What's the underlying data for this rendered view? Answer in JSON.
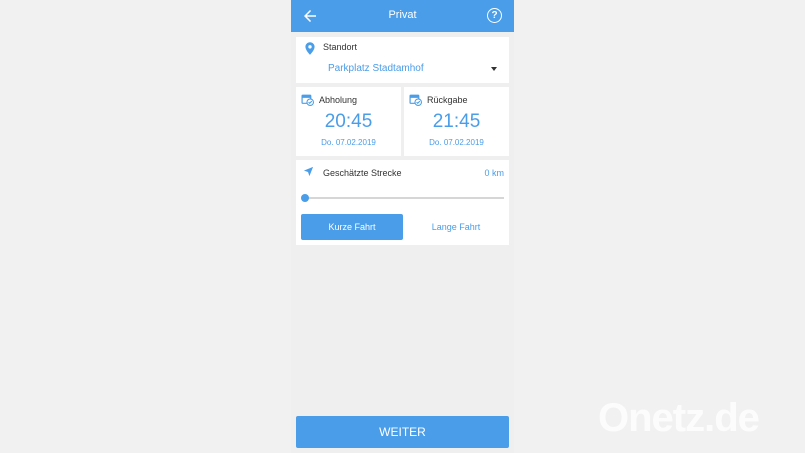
{
  "appbar": {
    "title": "Privat",
    "help_glyph": "?"
  },
  "location": {
    "label": "Standort",
    "value": "Parkplatz Stadtamhof"
  },
  "pickup": {
    "label": "Abholung",
    "time": "20:45",
    "date": "Do. 07.02.2019"
  },
  "return": {
    "label": "Rückgabe",
    "time": "21:45",
    "date": "Do. 07.02.2019"
  },
  "distance": {
    "label": "Geschätzte Strecke",
    "value": "0 km",
    "slider_fraction": 0
  },
  "buttons": {
    "short": "Kurze Fahrt",
    "long": "Lange Fahrt",
    "next": "WEITER"
  },
  "watermark": "Onetz.de",
  "colors": {
    "accent": "#4a9de8",
    "background": "#efefef"
  }
}
